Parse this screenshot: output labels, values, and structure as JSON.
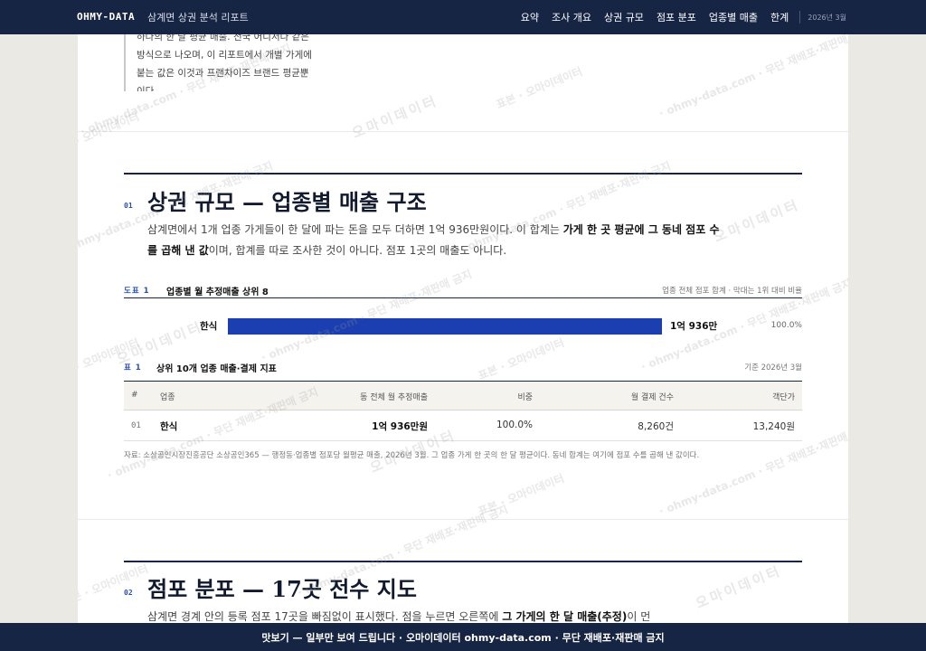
{
  "nav": {
    "brand": "OHMY-DATA",
    "title": "삼계면 상권 분석 리포트",
    "links": [
      "요약",
      "조사 개요",
      "상권 규모",
      "점포 분포",
      "업종별 매출",
      "한계"
    ],
    "date": "2026년 3월"
  },
  "quote": {
    "lines": [
      "하나의 한 달 평균 매출. 전국 어디서나 같은",
      "방식으로 나오며, 이 리포트에서 개별 가게에",
      "붙는 값은 이것과 프랜차이즈 브랜드 평균뿐",
      "이다."
    ]
  },
  "section1": {
    "num": "01",
    "title": "상권 규모 — 업종별 매출 구조",
    "para_a": "삼계면에서 1개 업종 가게들이 한 달에 파는 돈을 모두 더하면 1억 936만원이다. 이 합계는 ",
    "para_b": "가게 한 곳 평균에 그 동네 점포 수를 곱해 낸 값",
    "para_c": "이며, 합계를 따로 조사한 것이 아니다. 점포 1곳의 매출도 아니다."
  },
  "figure1": {
    "label": "도표 1",
    "title": "업종별 월 추정매출 상위 8",
    "note": "업종 전체 점포 합계 · 막대는 1위 대비 비율"
  },
  "chart_data": {
    "type": "bar",
    "categories": [
      "한식"
    ],
    "values": [
      10936
    ],
    "value_labels": [
      "1억 936만"
    ],
    "percent_labels": [
      "100.0%"
    ],
    "percent_of_max": [
      100.0
    ],
    "bar_color": "#1b3fb0"
  },
  "table1": {
    "label": "표 1",
    "title": "상위 10개 업종 매출·결제 지표",
    "note": "기준 2026년 3월",
    "headers": [
      "#",
      "업종",
      "동 전체 월 추정매출",
      "비중",
      "월 결제 건수",
      "객단가"
    ],
    "rows": [
      [
        "01",
        "한식",
        "1억 936만원",
        "100.0%",
        "8,260건",
        "13,240원"
      ]
    ]
  },
  "source": "자료: 소상공인시장진흥공단 소상공인365 — 행정동·업종별 점포당 월평균 매출, 2026년 3월. 그 업종 가게 한 곳의 한 달 평균이다. 동네 합계는 여기에 점포 수를 곱해 낸 값이다.",
  "section2": {
    "num": "02",
    "title": "점포 분포 — 17곳 전수 지도",
    "para_a": "삼계면 경계 안의 등록 점포 17곳을 빠짐없이 표시했다. 점을 누르면 오른쪽에 ",
    "para_b": "그 가게의 한 달 매출(추정)",
    "para_c": "이 먼"
  },
  "watermark": {
    "brand": "오마이데이터",
    "sample": "표본 · 오마이데이터",
    "line": "· ohmy-data.com · 무단 재배포·재판매 금지"
  },
  "footer": "맛보기 — 일부만 보여 드립니다 · 오마이데이터 ohmy-data.com · 무단 재배포·재판매 금지"
}
